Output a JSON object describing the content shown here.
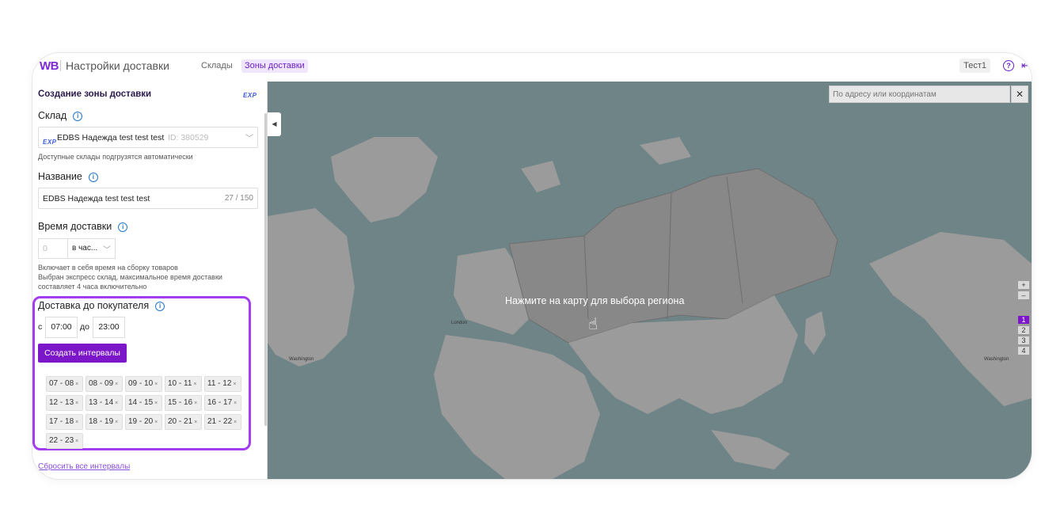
{
  "header": {
    "logo": "WB",
    "title": "Настройки доставки",
    "tabs": [
      {
        "label": "Склады",
        "active": false
      },
      {
        "label": "Зоны доставки",
        "active": true
      }
    ],
    "user": "Тест1"
  },
  "sidebar": {
    "title": "Создание зоны доставки",
    "exp_badge": "EXP",
    "warehouse": {
      "label": "Склад",
      "value": "EDBS Надежда test test test",
      "id": "ID: 380529",
      "hint": "Доступные склады подгрузятся автоматически"
    },
    "name": {
      "label": "Название",
      "value": "EDBS Надежда test test test",
      "counter": "27 / 150"
    },
    "delivery_time": {
      "label": "Время доставки",
      "amount_placeholder": "0",
      "unit": "в час...",
      "hint_line1": "Включает в себя время на сборку товаров",
      "hint_line2": "Выбран экспресс склад, максимальное время доставки",
      "hint_line3": "составляет 4 часа включительно"
    },
    "buyer_delivery": {
      "label": "Доставка до покупателя",
      "from_label": "с",
      "from_value": "07:00",
      "to_label": "до",
      "to_value": "23:00",
      "create_button": "Создать интервалы",
      "intervals": [
        "07 - 08",
        "08 - 09",
        "09 - 10",
        "10 - 11",
        "11 - 12",
        "12 - 13",
        "13 - 14",
        "14 - 15",
        "15 - 16",
        "16 - 17",
        "17 - 18",
        "18 - 19",
        "19 - 20",
        "20 - 21",
        "21 - 22",
        "22 - 23"
      ],
      "remove_glyph": "×"
    },
    "reset_link": "Сбросить все интервалы"
  },
  "map": {
    "search_placeholder": "По адресу или координатам",
    "close_glyph": "✕",
    "hint": "Нажмите на карту для выбора региона",
    "cursor_icon": "hand-pointer-icon",
    "controls": {
      "zoom_in": "+",
      "zoom_out": "–",
      "levels": [
        "1",
        "2",
        "3",
        "4"
      ],
      "active_level": "1"
    },
    "labels": [
      "London",
      "Washington",
      "Washington"
    ]
  },
  "colors": {
    "accent": "#7b16c9",
    "highlight": "#a23ef0",
    "sea": "#6f8487",
    "land": "#9b9b9b",
    "selected_region": "#888888"
  }
}
